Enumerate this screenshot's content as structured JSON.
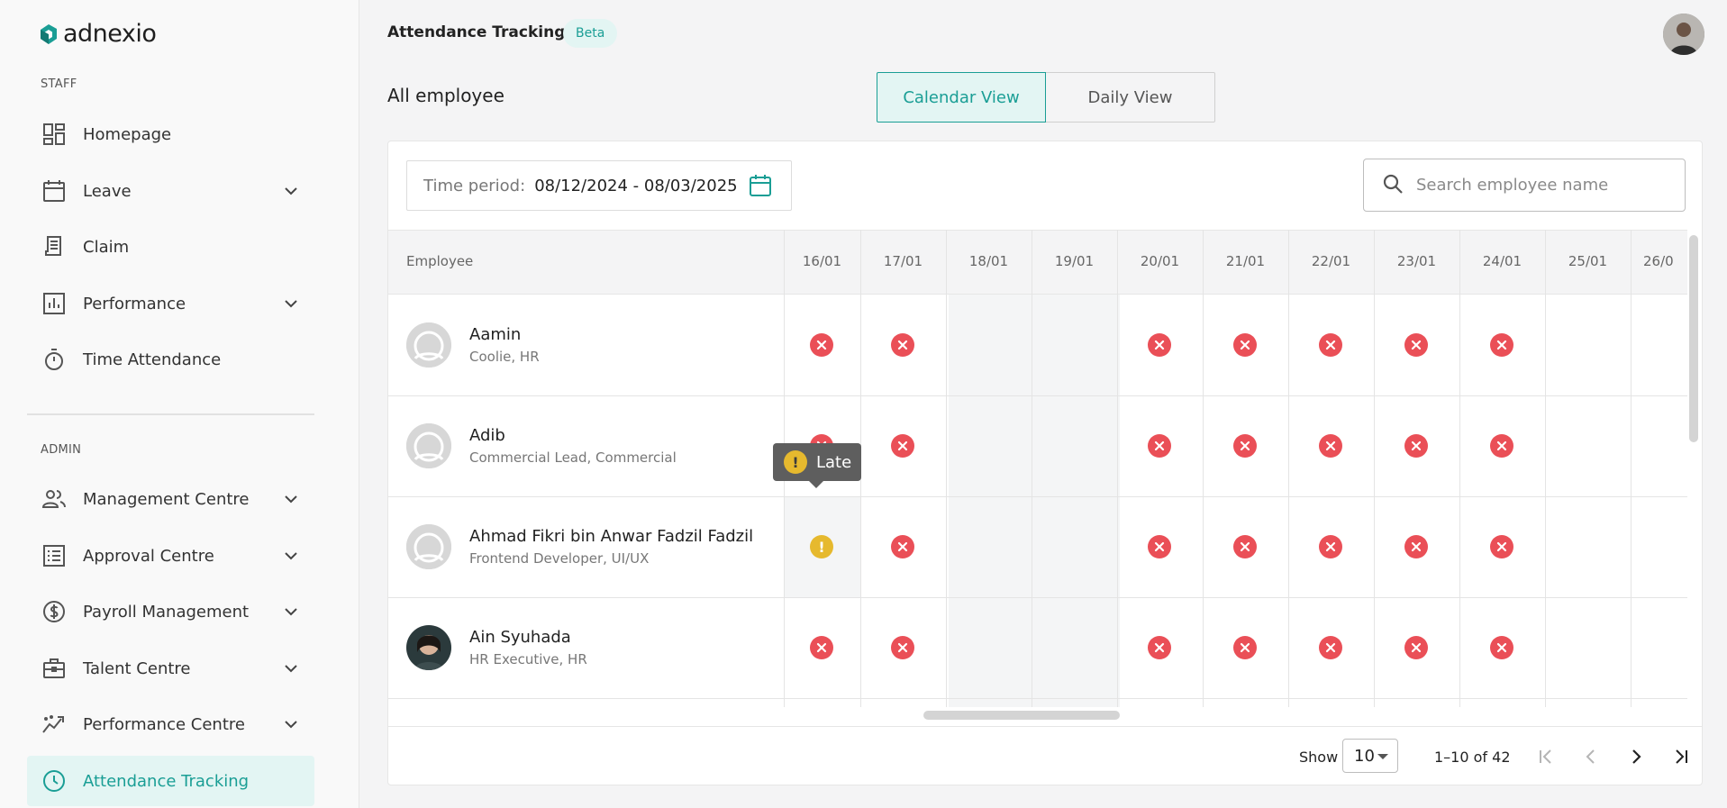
{
  "app": {
    "logo_text": "adnexio"
  },
  "sidebar": {
    "staff_label": "STAFF",
    "admin_label": "ADMIN",
    "staff_items": [
      {
        "label": "Homepage"
      },
      {
        "label": "Leave"
      },
      {
        "label": "Claim"
      },
      {
        "label": "Performance"
      },
      {
        "label": "Time Attendance"
      }
    ],
    "admin_items": [
      {
        "label": "Management Centre"
      },
      {
        "label": "Approval Centre"
      },
      {
        "label": "Payroll Management"
      },
      {
        "label": "Talent Centre"
      },
      {
        "label": "Performance Centre"
      },
      {
        "label": "Attendance Tracking"
      }
    ]
  },
  "header": {
    "title": "Attendance Tracking",
    "badge": "Beta"
  },
  "main": {
    "subtitle": "All employee",
    "views": [
      "Calendar View",
      "Daily View"
    ],
    "time_period_label": "Time period:",
    "time_period_value": "08/12/2024 - 08/03/2025",
    "search_placeholder": "Search employee name"
  },
  "table": {
    "employee_header": "Employee",
    "dates": [
      "16/01",
      "17/01",
      "18/01",
      "19/01",
      "20/01",
      "21/01",
      "22/01",
      "23/01",
      "24/01",
      "25/01",
      "26/0"
    ],
    "rows": [
      {
        "name": "Aamin",
        "role": "Coolie, HR",
        "statuses": [
          "absent",
          "absent",
          "",
          "",
          "absent",
          "absent",
          "absent",
          "absent",
          "absent",
          "",
          ""
        ]
      },
      {
        "name": "Adib",
        "role": "Commercial Lead, Commercial",
        "statuses": [
          "absent",
          "absent",
          "",
          "",
          "absent",
          "absent",
          "absent",
          "absent",
          "absent",
          "",
          ""
        ]
      },
      {
        "name": "Ahmad Fikri bin Anwar Fadzil Fadzil",
        "role": "Frontend Developer, UI/UX",
        "statuses": [
          "late",
          "absent",
          "",
          "",
          "absent",
          "absent",
          "absent",
          "absent",
          "absent",
          "",
          ""
        ]
      },
      {
        "name": "Ain Syuhada",
        "role": "HR Executive, HR",
        "statuses": [
          "absent",
          "absent",
          "",
          "",
          "absent",
          "absent",
          "absent",
          "absent",
          "absent",
          "",
          ""
        ]
      }
    ],
    "tooltip": "Late",
    "late_mark": "!"
  },
  "pagination": {
    "show_label": "Show",
    "page_size": "10",
    "range": "1–10 of 42"
  },
  "colors": {
    "accent": "#1a9e95",
    "absent": "#ea4f57",
    "late": "#e6b92e"
  }
}
